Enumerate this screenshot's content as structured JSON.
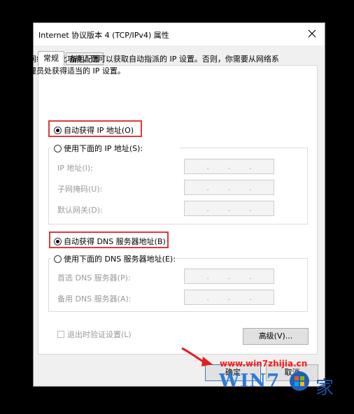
{
  "dialog": {
    "title": "Internet 协议版本 4 (TCP/IPv4) 属性",
    "close_icon": "close-icon"
  },
  "tabs": [
    {
      "label": "常规",
      "active": true
    },
    {
      "label": "备用配置",
      "active": false
    }
  ],
  "description": "如果网络支持此功能，则可以获取自动指派的 IP 设置。否则，你需要从网络系统管理员处获得适当的 IP 设置。",
  "ip_section": {
    "auto_label": "自动获得 IP 地址(O)",
    "auto_checked": true,
    "manual_label": "使用下面的 IP 地址(S):",
    "manual_checked": false,
    "fields": [
      {
        "label": "IP 地址(I):",
        "value": "   .   .   ."
      },
      {
        "label": "子网掩码(U):",
        "value": "   .   .   ."
      },
      {
        "label": "默认网关(D):",
        "value": "   .   .   ."
      }
    ]
  },
  "dns_section": {
    "auto_label": "自动获得 DNS 服务器地址(B)",
    "auto_checked": true,
    "manual_label": "使用下面的 DNS 服务器地址(E):",
    "manual_checked": false,
    "fields": [
      {
        "label": "首选 DNS 服务器(P):",
        "value": "   .   .   ."
      },
      {
        "label": "备用 DNS 服务器(A):",
        "value": "   .   .   ."
      }
    ]
  },
  "validate_label": "退出时验证设置(L)",
  "validate_checked": false,
  "buttons": {
    "advanced": "高级(V)...",
    "ok": "确定",
    "cancel": "取消"
  },
  "watermark": {
    "url": "www.win7zhijia.cn",
    "logo_text": "WIN7",
    "logo_cn": "家"
  },
  "colors": {
    "highlight": "#e03a3a",
    "watermark_url": "#ff1a1a",
    "logo_blue": "#2d7cd6"
  }
}
